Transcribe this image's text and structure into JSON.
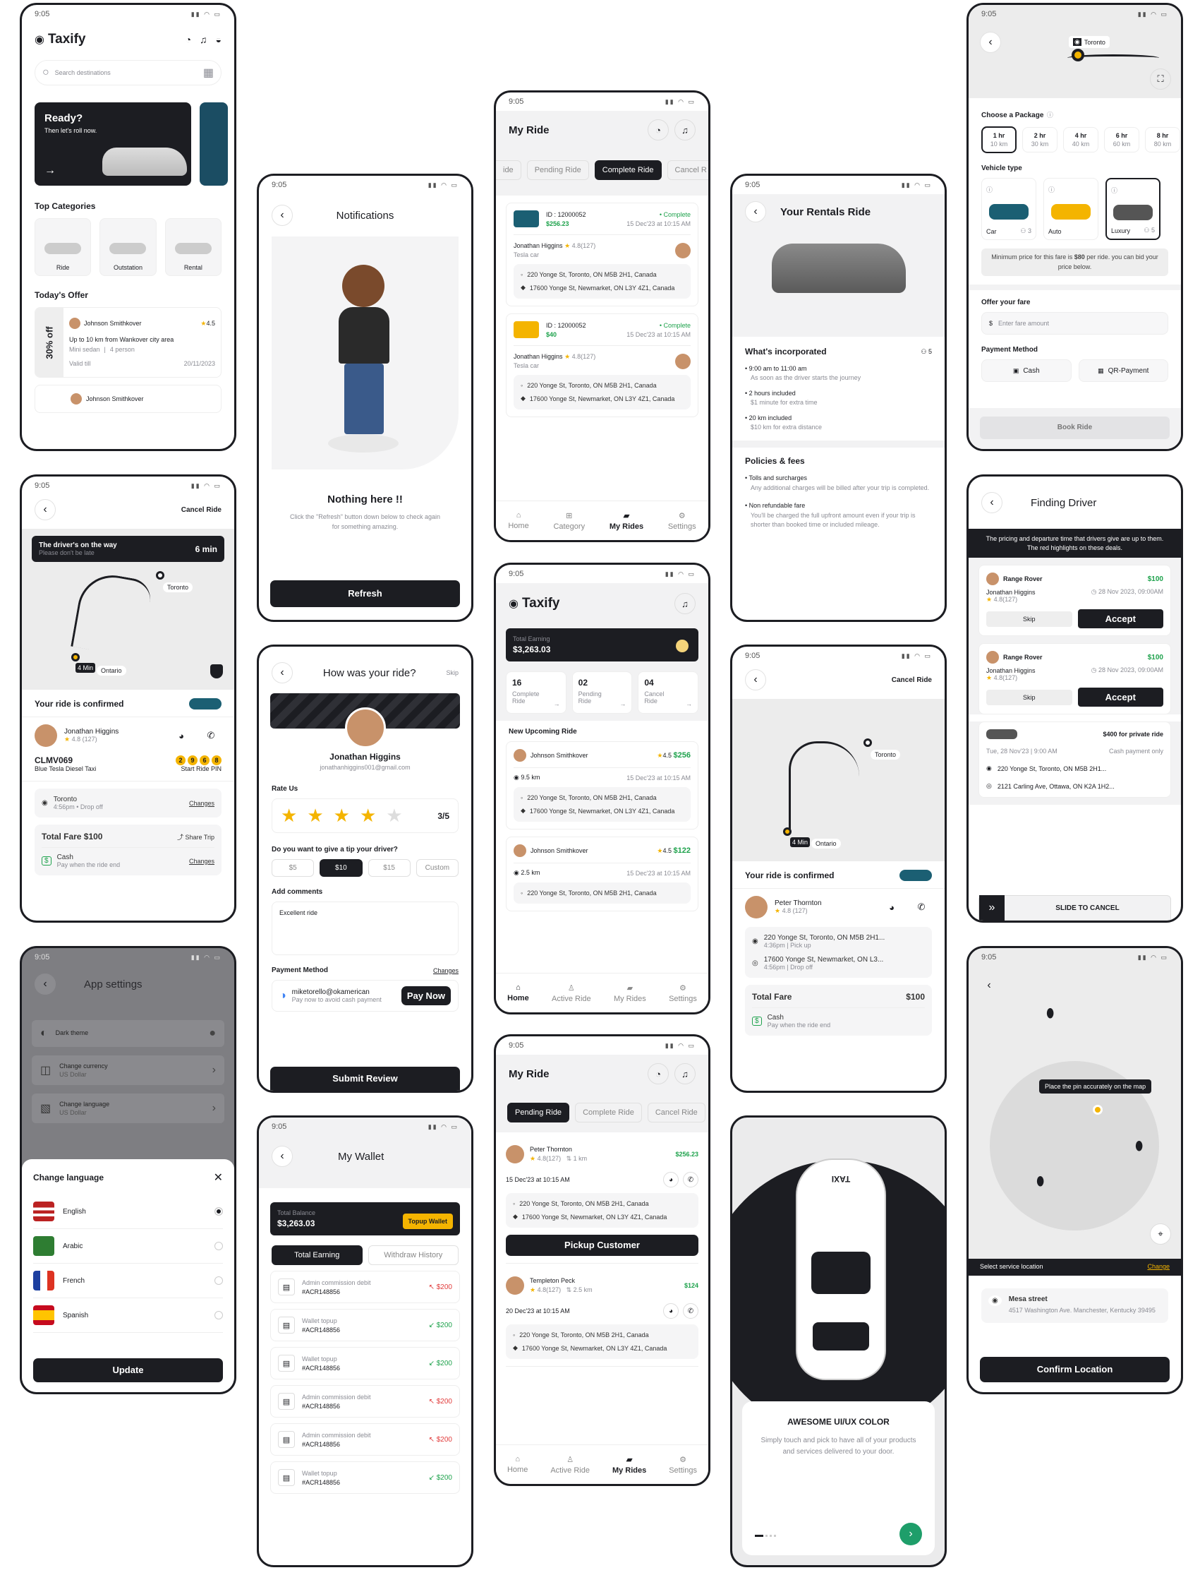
{
  "status_time": "9:05",
  "home": {
    "logo": "Taxify",
    "search_placeholder": "Search destinations",
    "banner_title": "Ready?",
    "banner_sub": "Then let's roll now.",
    "categories_title": "Top Categories",
    "categories": [
      "Ride",
      "Outstation",
      "Rental"
    ],
    "offer_title": "Today's Offer",
    "offer_badge": "30% off",
    "offer_name": "Johnson Smithkover",
    "offer_rating": "4.5",
    "offer_desc": "Up to 10 km from Wankover city area",
    "offer_car": "Mini sedan",
    "offer_people": "4 person",
    "offer_valid_label": "Valid till",
    "offer_valid": "20/11/2023",
    "offer2_name": "Johnson Smithkover"
  },
  "notif": {
    "title": "Notifications",
    "empty_title": "Nothing here !!",
    "empty_desc": "Click the \"Refresh\" button down below to check again for something amazing.",
    "refresh": "Refresh"
  },
  "myride1": {
    "title": "My Ride",
    "tabs": [
      "ide",
      "Pending Ride",
      "Complete Ride",
      "Cancel R"
    ],
    "trips": [
      {
        "id": "ID : 12000052",
        "status": "Complete",
        "price": "$256.23",
        "date": "15 Dec'23 at 10:15 AM",
        "driver": "Jonathan Higgins",
        "rating": "4.8(127)",
        "car": "Tesla car",
        "from": "220 Yonge St, Toronto, ON M5B 2H1, Canada",
        "to": "17600 Yonge St, Newmarket, ON L3Y 4Z1, Canada"
      },
      {
        "id": "ID : 12000052",
        "status": "Complete",
        "price": "$40",
        "date": "15 Dec'23 at 10:15 AM",
        "driver": "Jonathan Higgins",
        "rating": "4.8(127)",
        "car": "Tesla car",
        "from": "220 Yonge St, Toronto, ON M5B 2H1, Canada",
        "to": "17600 Yonge St, Newmarket, ON L3Y 4Z1, Canada"
      }
    ],
    "nav": [
      "Home",
      "Category",
      "My Rides",
      "Settings"
    ]
  },
  "rentals": {
    "title": "Your Rentals Ride",
    "inc_title": "What's incorporated",
    "seats": "5",
    "items": [
      {
        "t": "9:00 am to 11:00 am",
        "d": "As soon as the driver starts the journey"
      },
      {
        "t": "2 hours included",
        "d": "$1 minute for extra time"
      },
      {
        "t": "20 km included",
        "d": "$10 km  for extra distance"
      }
    ],
    "pol_title": "Policies & fees",
    "policies": [
      {
        "t": "Tolls and surcharges",
        "d": "Any additional charges will be billed after your trip is completed."
      },
      {
        "t": "Non refundable fare",
        "d": "You'll be charged the full upfront amount even if your trip is shorter than booked time or included mileage."
      }
    ]
  },
  "package": {
    "map_label": "Toronto",
    "choose": "Choose a Package",
    "packages": [
      {
        "h": "1 hr",
        "k": "10 km"
      },
      {
        "h": "2 hr",
        "k": "30 km"
      },
      {
        "h": "4 hr",
        "k": "40 km"
      },
      {
        "h": "6 hr",
        "k": "60 km"
      },
      {
        "h": "8 hr",
        "k": "80 km"
      }
    ],
    "vehicle_title": "Vehicle type",
    "vehicles": [
      {
        "n": "Car",
        "s": "3"
      },
      {
        "n": "Auto",
        "s": ""
      },
      {
        "n": "Luxury",
        "s": "5"
      }
    ],
    "note_pre": "Minimum price for this fare is ",
    "note_price": "$80",
    "note_post": " per ride. you can bid your price below.",
    "offer_title": "Offer your fare",
    "offer_placeholder": "Enter fare amount",
    "pay_title": "Payment Method",
    "pay": [
      "Cash",
      "QR-Payment"
    ],
    "book": "Book Ride"
  },
  "driverway": {
    "cancel": "Cancel Ride",
    "banner": "The driver's on the way",
    "banner_sub": "Please don't be late",
    "eta": "6 min",
    "map_a": "Toronto",
    "map_b": "Ontario",
    "eta_pin": "4 Min",
    "confirmed": "Your ride is confirmed",
    "driver": "Jonathan Higgins",
    "rating": "4.8 (127)",
    "plate": "CLMV069",
    "car": "Blue Tesla Diesel Taxi",
    "pin": [
      "2",
      "9",
      "6",
      "8"
    ],
    "pin_label": "Start Ride PIN",
    "loc": "Toronto",
    "loc_sub": "4:56pm  •  Drop off",
    "changes": "Changes",
    "fare": "Total Fare $100",
    "share": "Share Trip",
    "pay": "Cash",
    "pay_sub": "Pay when the ride end"
  },
  "rate": {
    "title": "How was your ride?",
    "skip": "Skip",
    "name": "Jonathan Higgins",
    "email": "jonathanhiggins001@gmail.com",
    "rate_us": "Rate Us",
    "score": "3/5",
    "stars": 4,
    "tip_q": "Do you want to give a tip your driver?",
    "tips": [
      "$5",
      "$10",
      "$15",
      "Custom"
    ],
    "comments": "Add comments",
    "comment_val": "Excellent ride",
    "pay_title": "Payment Method",
    "changes": "Changes",
    "pay_email": "miketorello@okamerican",
    "pay_sub": "Pay now to avoid cash payment",
    "pay_now": "Pay Now",
    "submit": "Submit Review"
  },
  "home2": {
    "logo": "Taxify",
    "earn_label": "Total Earning",
    "earn": "$3,263.03",
    "stats": [
      {
        "n": "16",
        "l": "Complete Ride"
      },
      {
        "n": "02",
        "l": "Pending Ride"
      },
      {
        "n": "04",
        "l": "Cancel Ride"
      }
    ],
    "upcoming": "New Upcoming Ride",
    "rides": [
      {
        "name": "Johnson Smithkover",
        "rating": "4.5",
        "price": "$256",
        "km": "9.5 km",
        "date": "15 Dec'23 at 10:15 AM",
        "from": "220 Yonge St, Toronto, ON M5B 2H1, Canada",
        "to": "17600 Yonge St, Newmarket, ON L3Y 4Z1, Canada"
      },
      {
        "name": "Johnson Smithkover",
        "rating": "4.5",
        "price": "$122",
        "km": "2.5 km",
        "date": "15 Dec'23 at 10:15 AM",
        "from": "220 Yonge St, Toronto, ON M5B 2H1, Canada"
      }
    ],
    "nav": [
      "Home",
      "Active Ride",
      "My Rides",
      "Settings"
    ]
  },
  "confirmed2": {
    "cancel": "Cancel Ride",
    "map_a": "Toronto",
    "map_b": "Ontario",
    "eta_pin": "4 Min",
    "title": "Your ride is confirmed",
    "driver": "Peter Thornton",
    "rating": "4.8 (127)",
    "from": "220 Yonge St, Toronto, ON M5B 2H1...",
    "from_sub": "4:36pm  |  Pick up",
    "to": "17600 Yonge St, Newmarket, ON L3...",
    "to_sub": "4:56pm  |  Drop off",
    "fare_label": "Total Fare",
    "fare": "$100",
    "pay": "Cash",
    "pay_sub": "Pay when the ride end"
  },
  "finding": {
    "title": "Finding Driver",
    "banner": "The pricing and departure time that drivers give are up to them. The red highlights on these deals.",
    "offers": [
      {
        "car": "Range Rover",
        "price": "$100",
        "driver": "Jonathan Higgins",
        "date": "28 Nov 2023, 09:00AM",
        "rating": "4.8(127)",
        "skip": "Skip",
        "accept": "Accept"
      },
      {
        "car": "Range Rover",
        "price": "$100",
        "driver": "Jonathan Higgins",
        "date": "28 Nov 2023, 09:00AM",
        "rating": "4.8(127)",
        "skip": "Skip",
        "accept": "Accept"
      }
    ],
    "private": "$400 for private ride",
    "private_date": "Tue, 28 Nov'23 | 9:00 AM",
    "private_pay": "Cash payment only",
    "from": "220 Yonge St, Toronto, ON M5B 2H1...",
    "to": "2121 Carling Ave, Ottawa, ON K2A 1H2...",
    "slide": "SLIDE TO CANCEL"
  },
  "settings": {
    "title": "App settings",
    "items": [
      {
        "t": "Dark theme",
        "s": ""
      },
      {
        "t": "Change currency",
        "s": "US Dollar"
      },
      {
        "t": "Change language",
        "s": "US Dollar"
      }
    ],
    "sheet_title": "Change language",
    "langs": [
      "English",
      "Arabic",
      "French",
      "Spanish"
    ],
    "update": "Update"
  },
  "wallet": {
    "title": "My Wallet",
    "bal_label": "Total Balance",
    "bal": "$3,263.03",
    "topup": "Topup Wallet",
    "tabs": [
      "Total Earning",
      "Withdraw History"
    ],
    "tx": [
      {
        "t": "Admin commission debit",
        "id": "#ACR148856",
        "a": "$200",
        "dir": "out"
      },
      {
        "t": "Wallet topup",
        "id": "#ACR148856",
        "a": "$200",
        "dir": "in"
      },
      {
        "t": "Wallet topup",
        "id": "#ACR148856",
        "a": "$200",
        "dir": "in"
      },
      {
        "t": "Admin commission debit",
        "id": "#ACR148856",
        "a": "$200",
        "dir": "out"
      },
      {
        "t": "Admin commission debit",
        "id": "#ACR148856",
        "a": "$200",
        "dir": "out"
      },
      {
        "t": "Wallet topup",
        "id": "#ACR148856",
        "a": "$200",
        "dir": "in"
      }
    ]
  },
  "myride2": {
    "title": "My Ride",
    "tabs": [
      "Pending Ride",
      "Complete Ride",
      "Cancel Ride"
    ],
    "rides": [
      {
        "name": "Peter Thornton",
        "price": "$256.23",
        "rating": "4.8(127)",
        "km": "1 km",
        "date": "15 Dec'23 at 10:15 AM",
        "from": "220 Yonge St, Toronto, ON M5B 2H1, Canada",
        "to": "17600 Yonge St, Newmarket, ON L3Y 4Z1, Canada",
        "btn": "Pickup Customer"
      },
      {
        "name": "Templeton Peck",
        "price": "$124",
        "rating": "4.8(127)",
        "km": "2.5 km",
        "date": "20 Dec'23 at 10:15 AM",
        "from": "220 Yonge St, Toronto, ON M5B 2H1, Canada",
        "to": "17600 Yonge St, Newmarket, ON L3Y 4Z1, Canada"
      }
    ],
    "nav": [
      "Home",
      "Active Ride",
      "My Rides",
      "Settings"
    ]
  },
  "onboard": {
    "taxi": "TAXI",
    "title": "AWESOME UI/UX COLOR",
    "desc": "Simply touch and pick to have all of your products and services delivered to your door."
  },
  "location": {
    "tooltip": "Place the pin accurately on the map",
    "select": "Select service location",
    "change": "Change",
    "name": "Mesa street",
    "addr": "4517 Washington Ave. Manchester, Kentucky 39495",
    "confirm": "Confirm Location"
  }
}
